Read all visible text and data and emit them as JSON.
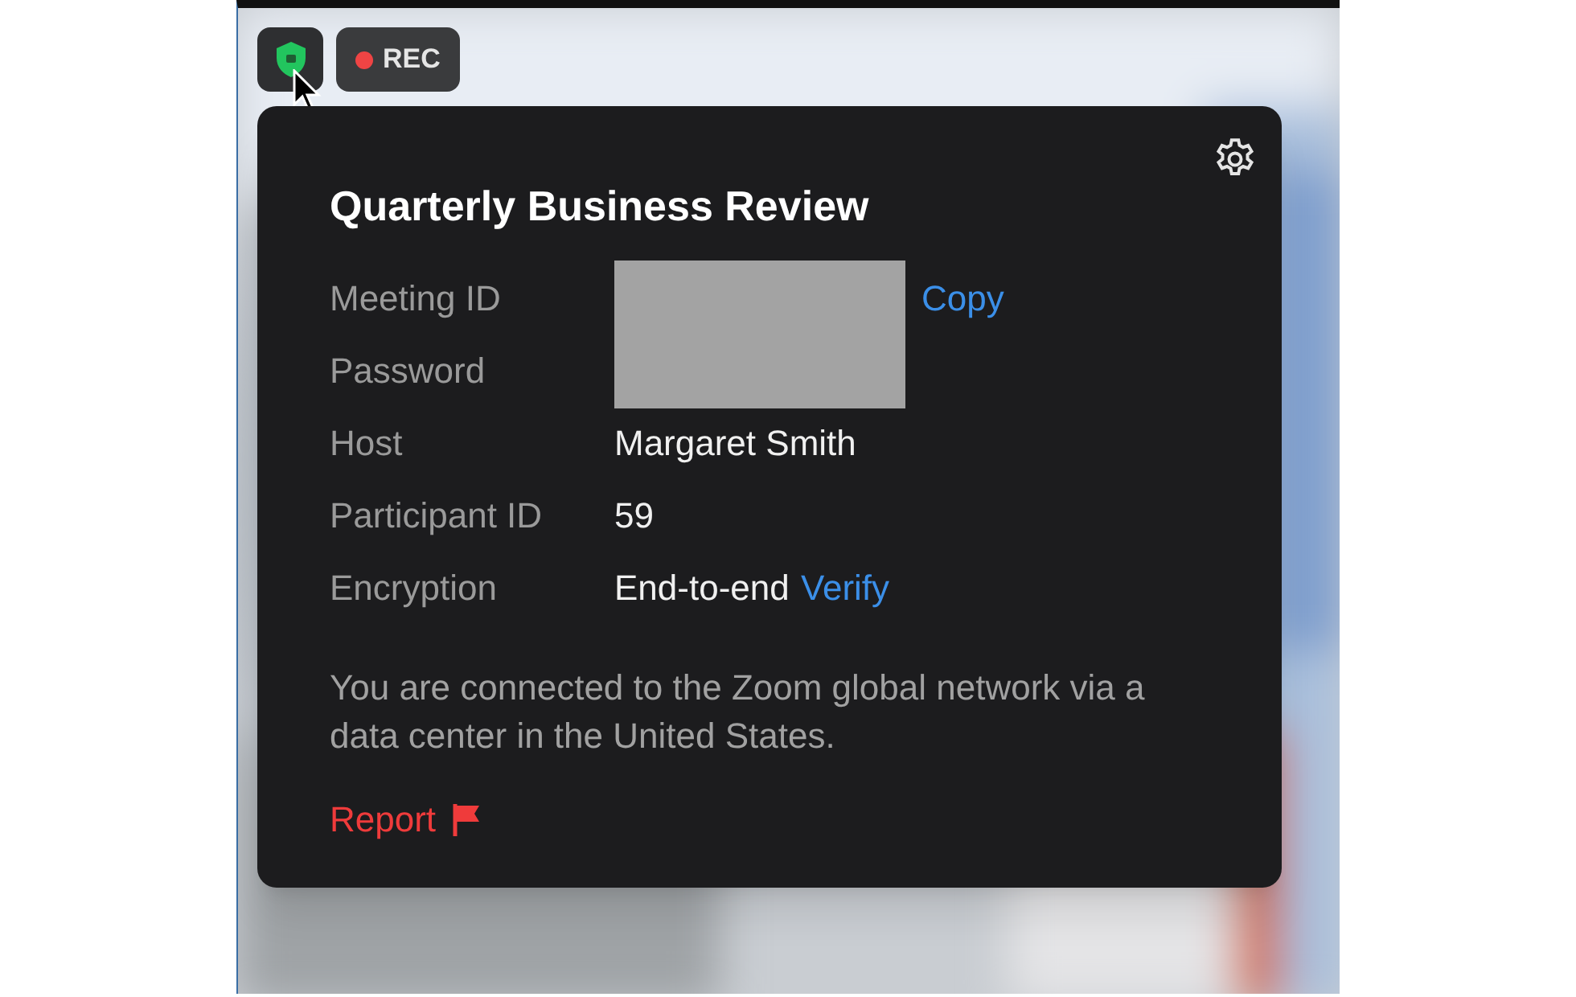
{
  "toolbar": {
    "recording": {
      "label": "REC"
    }
  },
  "popup": {
    "title": "Quarterly Business Review",
    "details": [
      {
        "label": "Meeting ID",
        "redacted": true,
        "link": "Copy"
      },
      {
        "label": "Password",
        "redacted": true
      },
      {
        "label": "Host",
        "value": "Margaret Smith"
      },
      {
        "label": "Participant ID",
        "value": "59"
      },
      {
        "label": "Encryption",
        "value": "End-to-end",
        "link": "Verify"
      }
    ],
    "note": "You are connected to the Zoom global network via a data center in the United States.",
    "report": "Report"
  }
}
